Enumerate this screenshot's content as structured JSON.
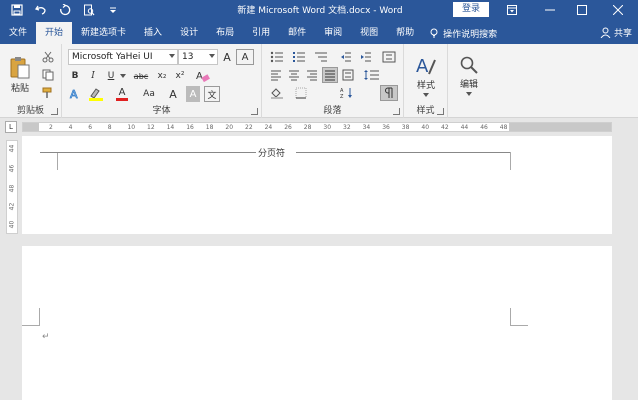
{
  "titlebar": {
    "doc_title": "新建 Microsoft Word 文档.docx - Word",
    "login_label": "登录",
    "qat_icons": [
      "save-icon",
      "undo-icon",
      "redo-icon",
      "print-preview-icon",
      "customize-qat-icon"
    ],
    "window_icons": [
      "ribbon-options-icon",
      "minimize-icon",
      "maximize-icon",
      "close-icon"
    ]
  },
  "tabs": [
    {
      "label": "文件",
      "active": false
    },
    {
      "label": "开始",
      "active": true
    },
    {
      "label": "新建选项卡",
      "active": false
    },
    {
      "label": "插入",
      "active": false
    },
    {
      "label": "设计",
      "active": false
    },
    {
      "label": "布局",
      "active": false
    },
    {
      "label": "引用",
      "active": false
    },
    {
      "label": "邮件",
      "active": false
    },
    {
      "label": "审阅",
      "active": false
    },
    {
      "label": "视图",
      "active": false
    },
    {
      "label": "帮助",
      "active": false
    }
  ],
  "tell_me": "操作说明搜索",
  "share": "共享",
  "ribbon": {
    "clipboard": {
      "label": "剪贴板",
      "paste_label": "粘贴"
    },
    "font": {
      "label": "字体",
      "font_name": "Microsoft YaHei UI",
      "font_size": "13",
      "bold": "B",
      "italic": "I",
      "underline": "U",
      "strike": "abc",
      "subscript": "x₂",
      "superscript": "x²",
      "font_color": "A",
      "case": "Aa",
      "grow": "A",
      "shrink": "A",
      "char_border": "A",
      "phonetic": "文"
    },
    "paragraph": {
      "label": "段落"
    },
    "styles": {
      "label": "样式",
      "button_label": "样式"
    },
    "editing": {
      "button_label": "编辑"
    }
  },
  "ruler": {
    "numbers": [
      "2",
      "4",
      "6",
      "8",
      "10",
      "12",
      "14",
      "16",
      "18",
      "20",
      "22",
      "24",
      "26",
      "28",
      "30",
      "32",
      "34",
      "36",
      "38",
      "40",
      "42",
      "44",
      "46",
      "48"
    ],
    "vertical_numbers": [
      "44",
      "46",
      "48",
      "42",
      "40"
    ]
  },
  "document": {
    "page_break_label": "分页符",
    "paragraph_mark": "↵"
  },
  "colors": {
    "accent": "#2b579a",
    "ribbon_bg": "#f3f3f3",
    "font_color_red": "#e02020",
    "highlight_yellow": "#ffff00"
  }
}
